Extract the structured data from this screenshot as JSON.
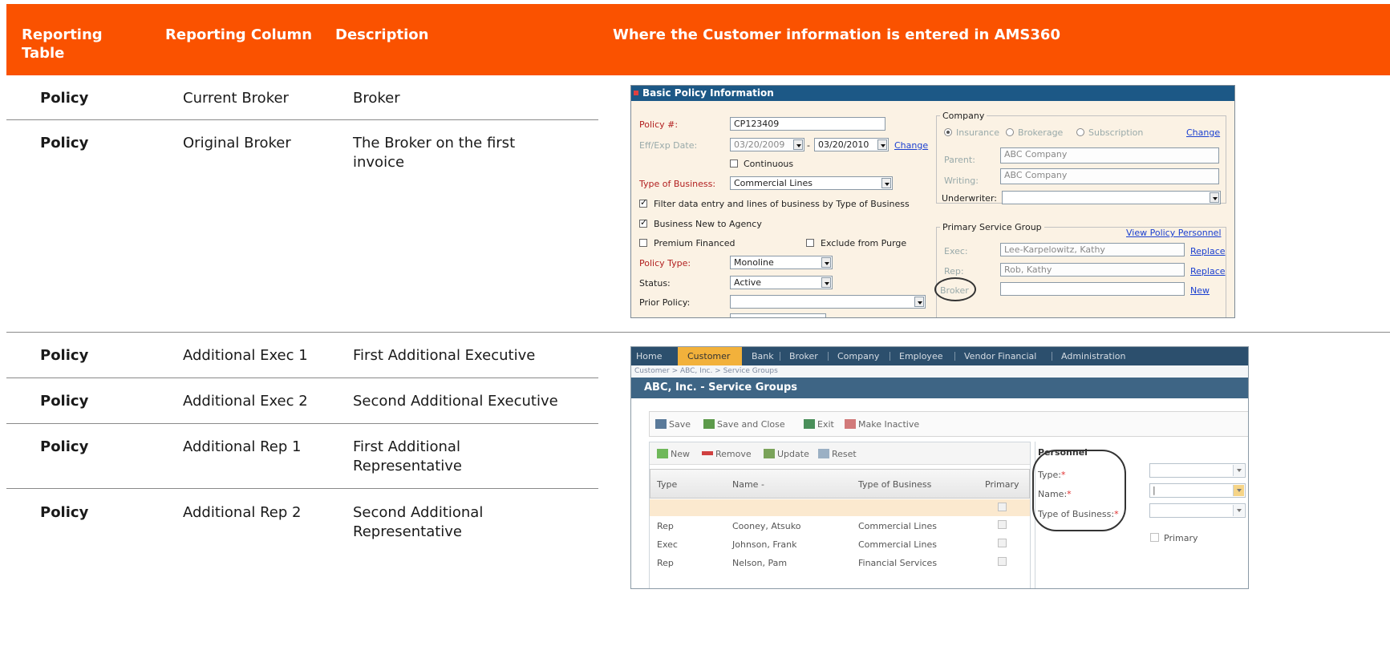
{
  "header": {
    "col1": "Reporting Table",
    "col2": "Reporting Column",
    "col3": "Description",
    "col4": "Where the Customer information is entered in AMS360"
  },
  "rows": [
    {
      "table": "Policy",
      "column": "Current Broker",
      "description": "Broker"
    },
    {
      "table": "Policy",
      "column": "Original Broker",
      "description": "The Broker on the first invoice"
    },
    {
      "table": "Policy",
      "column": "Additional Exec 1",
      "description": "First Additional Executive"
    },
    {
      "table": "Policy",
      "column": "Additional Exec 2",
      "description": "Second Additional Executive"
    },
    {
      "table": "Policy",
      "column": "Additional Rep 1",
      "description": "First Additional Representative"
    },
    {
      "table": "Policy",
      "column": "Additional Rep 2",
      "description": "Second Additional Representative"
    }
  ],
  "colors": {
    "header_bg": "#fa5200",
    "header_text": "#ffffff",
    "divider": "#8a8a8a"
  },
  "screenshot1": {
    "title": "Basic Policy Information",
    "policy_label": "Policy #:",
    "policy_value": "CP123409",
    "effexp_label": "Eff/Exp Date:",
    "eff_date": "03/20/2009",
    "dash": "-",
    "exp_date": "03/20/2010",
    "change_link": "Change",
    "continuous_label": "Continuous",
    "tob_label": "Type of Business:",
    "tob_value": "Commercial Lines",
    "filter_label": "Filter data entry and lines of business by Type of Business",
    "bnta_label": "Business New to Agency",
    "premium_label": "Premium Financed",
    "exclude_label": "Exclude from Purge",
    "ptype_label": "Policy Type:",
    "ptype_value": "Monoline",
    "status_label": "Status:",
    "status_value": "Active",
    "prior_label": "Prior Policy:",
    "company_legend": "Company",
    "insurance_label": "Insurance",
    "brokerage_label": "Brokerage",
    "subscription_label": "Subscription",
    "company_change": "Change",
    "parent_label": "Parent:",
    "parent_value": "ABC Company",
    "writing_label": "Writing:",
    "writing_value": "ABC Company",
    "underwriter_label": "Underwriter:",
    "psg_legend": "Primary Service Group",
    "view_personnel": "View Policy Personnel",
    "exec_label": "Exec:",
    "exec_value": "Lee-Karpelowitz, Kathy",
    "rep_label": "Rep:",
    "rep_value": "Rob, Kathy",
    "broker_label": "Broker",
    "replace1": "Replace",
    "replace2": "Replace",
    "new_link": "New"
  },
  "screenshot2": {
    "nav": [
      "Home",
      "Customer",
      "Bank",
      "Broker",
      "Company",
      "Employee",
      "Vendor Financial",
      "Administration"
    ],
    "breadcrumb": "Customer > ABC, Inc. > Service Groups",
    "title": "ABC, Inc. - Service Groups",
    "toolbar": {
      "save": "Save",
      "save_close": "Save and Close",
      "exit": "Exit",
      "make_inactive": "Make Inactive"
    },
    "grid_toolbar": {
      "new": "New",
      "remove": "Remove",
      "update": "Update",
      "reset": "Reset"
    },
    "grid_headers": {
      "type": "Type",
      "name": "Name -",
      "tob": "Type of Business",
      "primary": "Primary"
    },
    "grid_rows": [
      {
        "type": "Rep",
        "name": "Cooney, Atsuko",
        "tob": "Commercial Lines"
      },
      {
        "type": "Exec",
        "name": "Johnson, Frank",
        "tob": "Commercial Lines"
      },
      {
        "type": "Rep",
        "name": "Nelson, Pam",
        "tob": "Financial Services"
      }
    ],
    "personnel": {
      "heading": "Personnel",
      "type_label": "Type:",
      "name_label": "Name:",
      "name_value": "|",
      "tob_label": "Type of Business:",
      "required_mark": "*",
      "primary_label": "Primary"
    }
  }
}
